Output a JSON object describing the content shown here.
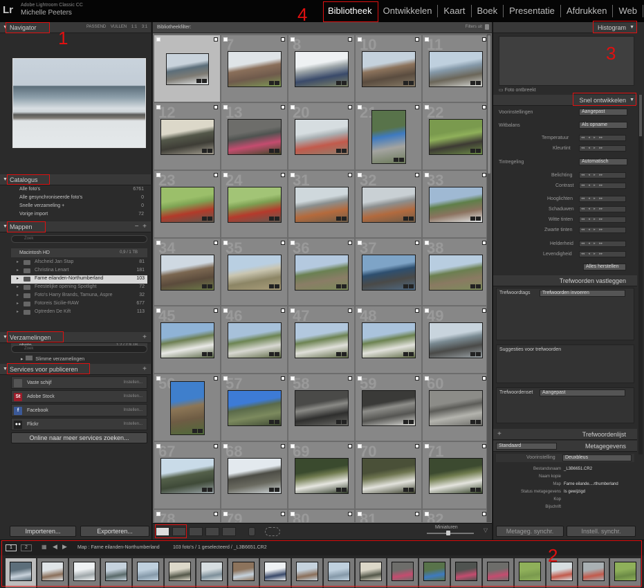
{
  "app": {
    "name": "Adobe Lightroom Classic CC",
    "user": "Michelle Peeters",
    "logo": "Lr"
  },
  "modules": [
    "Bibliotheek",
    "Ontwikkelen",
    "Kaart",
    "Boek",
    "Presentatie",
    "Afdrukken",
    "Web"
  ],
  "active_module": "Bibliotheek",
  "annotations": [
    "1",
    "2",
    "3",
    "4"
  ],
  "left": {
    "navigator": {
      "title": "Navigator",
      "options": "PASSEND  VULLEN  1:1  3:1"
    },
    "catalog": {
      "title": "Catalogus",
      "items": [
        {
          "label": "Alle foto's",
          "value": "6761"
        },
        {
          "label": "Alle gesynchroniseerde foto's",
          "value": "0"
        },
        {
          "label": "Snelle verzameling +",
          "value": "0"
        },
        {
          "label": "Vorige import",
          "value": "72"
        }
      ]
    },
    "folders": {
      "title": "Mappen",
      "filter_placeholder": "Zoek",
      "volume": {
        "name": "Macintosh HD",
        "size": "0,9 / 1 TB"
      },
      "items": [
        {
          "label": "Afscheid Jan Stap",
          "value": "81"
        },
        {
          "label": "Christina Lenart",
          "value": "181"
        },
        {
          "label": "Farne eilanden-Northumberland",
          "value": "103"
        },
        {
          "label": "Feestelijke opening Spotlight",
          "value": "72"
        },
        {
          "label": "Foto's Harry Brands, Tamuna, Aspre",
          "value": "32"
        },
        {
          "label": "Fotoreis Sicilie-RAW",
          "value": "677"
        },
        {
          "label": "Optreden De Kift",
          "value": "113"
        }
      ],
      "photo": {
        "name": "photo",
        "size": "1,2 / 2,9 TB"
      }
    },
    "collections": {
      "title": "Verzamelingen",
      "filter_placeholder": "Zoek",
      "smart": "Slimme verzamelingen"
    },
    "services": {
      "title": "Services voor publiceren",
      "items": [
        {
          "label": "Vaste schijf",
          "action": "Instellen...",
          "color": "#555555",
          "glyph": ""
        },
        {
          "label": "Adobe Stock",
          "action": "Instellen...",
          "color": "#9c1d2a",
          "glyph": "St"
        },
        {
          "label": "Facebook",
          "action": "Instellen...",
          "color": "#3b5998",
          "glyph": "f"
        },
        {
          "label": "Flickr",
          "action": "Instellen...",
          "color": "#222222",
          "glyph": "●●"
        }
      ],
      "more": "Online naar meer services zoeken..."
    },
    "import_btn": "Importeren...",
    "export_btn": "Exporteren..."
  },
  "center": {
    "filter_label": "Bibliotheekfilter:",
    "filter_right": "Filters uit",
    "mini_label": "Miniaturen",
    "cells": [
      {
        "num": "",
        "colors": [
          "#c9d3dc",
          "#5c6e7a",
          "#7e7b74",
          "#e5e9eb"
        ],
        "w": 62,
        "h": 46,
        "sel": true
      },
      {
        "num": "7",
        "colors": [
          "#dfe4e7",
          "#8a6f5a",
          "#6f5a4c",
          "#7d9a55"
        ],
        "w": 78,
        "h": 52
      },
      {
        "num": "8",
        "colors": [
          "#eef1f3",
          "#9fa7aa",
          "#3a4a6a",
          "#7f8466"
        ],
        "w": 78,
        "h": 52
      },
      {
        "num": "10",
        "colors": [
          "#c5d2dd",
          "#8c735c",
          "#5a4c3f",
          "#867a66"
        ],
        "w": 78,
        "h": 52
      },
      {
        "num": "11",
        "colors": [
          "#bfd0de",
          "#8599a9",
          "#6b6659",
          "#d4d6d3"
        ],
        "w": 78,
        "h": 52
      },
      {
        "num": "12",
        "colors": [
          "#dcd8c9",
          "#54584a",
          "#3e3d36",
          "#a39e90"
        ],
        "w": 78,
        "h": 52
      },
      {
        "num": "13",
        "colors": [
          "#6d6d6a",
          "#4f5350",
          "#c44c6f",
          "#3f4a2a"
        ],
        "w": 78,
        "h": 52
      },
      {
        "num": "20",
        "colors": [
          "#d6dde0",
          "#a9b0b3",
          "#c25a4c",
          "#8f7f6c"
        ],
        "w": 78,
        "h": 52
      },
      {
        "num": "21",
        "colors": [
          "#58734a",
          "#3e7ac0",
          "#a4a4a0",
          "#6b7a5a"
        ],
        "w": 50,
        "h": 78
      },
      {
        "num": "22",
        "colors": [
          "#7a9a4e",
          "#8fb05a",
          "#3d3a34",
          "#6b8a45"
        ],
        "w": 78,
        "h": 52
      },
      {
        "num": "23",
        "colors": [
          "#9bbf6a",
          "#7fa454",
          "#b23a2a",
          "#5c5a50"
        ],
        "w": 78,
        "h": 52
      },
      {
        "num": "24",
        "colors": [
          "#a2c476",
          "#7d9f52",
          "#b53a2c",
          "#5f5b52"
        ],
        "w": 78,
        "h": 52
      },
      {
        "num": "31",
        "colors": [
          "#cfd8dc",
          "#8a8f8f",
          "#b56a3c",
          "#6e5e4a"
        ],
        "w": 78,
        "h": 52
      },
      {
        "num": "32",
        "colors": [
          "#c9d0d4",
          "#8c8f8f",
          "#b26a3e",
          "#6d5c48"
        ],
        "w": 78,
        "h": 52
      },
      {
        "num": "33",
        "colors": [
          "#9fb9d3",
          "#5f7f49",
          "#8c7360",
          "#e3e8ea"
        ],
        "w": 78,
        "h": 52
      },
      {
        "num": "34",
        "colors": [
          "#cfd9e2",
          "#7b6751",
          "#5b4b3c",
          "#6c7a48"
        ],
        "w": 78,
        "h": 52
      },
      {
        "num": "35",
        "colors": [
          "#b9cfe2",
          "#c9c5b0",
          "#8c8565",
          "#a99d7a"
        ],
        "w": 78,
        "h": 52
      },
      {
        "num": "36",
        "colors": [
          "#b4c9df",
          "#6a8052",
          "#8a7d66",
          "#7a8a5a"
        ],
        "w": 78,
        "h": 52
      },
      {
        "num": "37",
        "colors": [
          "#7ea4c7",
          "#2e4f6f",
          "#4a4a48",
          "#4f6a84"
        ],
        "w": 78,
        "h": 52
      },
      {
        "num": "38",
        "colors": [
          "#b8cde0",
          "#6b7f50",
          "#8a7a62",
          "#7c8c5c"
        ],
        "w": 78,
        "h": 52
      },
      {
        "num": "45",
        "colors": [
          "#8fb3d6",
          "#6d7f52",
          "#e9e9e6",
          "#5c6a48"
        ],
        "w": 78,
        "h": 52
      },
      {
        "num": "46",
        "colors": [
          "#a7c1da",
          "#6c8452",
          "#d8d8d2",
          "#5e6a45"
        ],
        "w": 78,
        "h": 52
      },
      {
        "num": "47",
        "colors": [
          "#b2c8de",
          "#6d8352",
          "#e0e0da",
          "#5f6b46"
        ],
        "w": 78,
        "h": 52
      },
      {
        "num": "48",
        "colors": [
          "#aac3dc",
          "#6c8250",
          "#e2e2dc",
          "#5f6b45"
        ],
        "w": 78,
        "h": 52
      },
      {
        "num": "49",
        "colors": [
          "#c8d4dd",
          "#7a8a92",
          "#4a4a48",
          "#9aa2a6"
        ],
        "w": 78,
        "h": 52
      },
      {
        "num": "56",
        "colors": [
          "#3f7fcc",
          "#8c7656",
          "#6e5c44",
          "#4f6a3a"
        ],
        "w": 50,
        "h": 78
      },
      {
        "num": "57",
        "colors": [
          "#3d7bd6",
          "#5a6a4a",
          "#7c8a5e",
          "#3f4a34"
        ],
        "w": 78,
        "h": 52
      },
      {
        "num": "58",
        "colors": [
          "#4a4a48",
          "#8a8a86",
          "#2f2f2e",
          "#6a6a66"
        ],
        "w": 78,
        "h": 52
      },
      {
        "num": "59",
        "colors": [
          "#3a3a38",
          "#8e8e8a",
          "#555552",
          "#dcdcd8"
        ],
        "w": 78,
        "h": 52
      },
      {
        "num": "60",
        "colors": [
          "#8c8c88",
          "#5c5c58",
          "#b4b4ae",
          "#6c6c68"
        ],
        "w": 78,
        "h": 52
      },
      {
        "num": "67",
        "colors": [
          "#c9dbe8",
          "#54604a",
          "#3f4a38",
          "#9aa4a8"
        ],
        "w": 78,
        "h": 52
      },
      {
        "num": "68",
        "colors": [
          "#e3e9ee",
          "#4d4d46",
          "#6a6a60",
          "#cfd6da"
        ],
        "w": 78,
        "h": 52
      },
      {
        "num": "69",
        "colors": [
          "#3a4a2e",
          "#6f7a4e",
          "#e6e6e0",
          "#2f3a28"
        ],
        "w": 78,
        "h": 52
      },
      {
        "num": "70",
        "colors": [
          "#4a5038",
          "#6e7550",
          "#e2e2dc",
          "#3a3f2c"
        ],
        "w": 78,
        "h": 52
      },
      {
        "num": "71",
        "colors": [
          "#3c4a30",
          "#707c4e",
          "#e4e4de",
          "#324026"
        ],
        "w": 78,
        "h": 52
      },
      {
        "num": "78",
        "colors": [
          "#878787",
          "#878787",
          "#878787",
          "#878787"
        ],
        "w": 0,
        "h": 0
      },
      {
        "num": "79",
        "colors": [
          "#878787",
          "#878787",
          "#878787",
          "#878787"
        ],
        "w": 0,
        "h": 0
      },
      {
        "num": "80",
        "colors": [
          "#878787",
          "#878787",
          "#878787",
          "#878787"
        ],
        "w": 0,
        "h": 0
      },
      {
        "num": "81",
        "colors": [
          "#878787",
          "#878787",
          "#878787",
          "#878787"
        ],
        "w": 0,
        "h": 0
      },
      {
        "num": "82",
        "colors": [
          "#878787",
          "#878787",
          "#878787",
          "#878787"
        ],
        "w": 0,
        "h": 0
      }
    ]
  },
  "right": {
    "histogram": {
      "title": "Histogram",
      "caption": "Foto ontbreekt"
    },
    "quick_develop": {
      "title": "Snel ontwikkelen",
      "preset_label": "Voorinstellingen",
      "preset_value": "Aangepast",
      "wb_label": "Witbalans",
      "wb_value": "Als opname",
      "temp": "Temperatuur",
      "tint": "Kleurtint",
      "tone_label": "Tintregeling",
      "tone_value": "Automatisch",
      "exposure": "Belichting",
      "contrast": "Contrast",
      "highlights": "Hooglichten",
      "shadows": "Schaduwen",
      "whites": "Witte tinten",
      "blacks": "Zwarte tinten",
      "clarity": "Helderheid",
      "vibrance": "Levendigheid",
      "reset": "Alles herstellen"
    },
    "keywording": {
      "title": "Trefwoorden vastleggen",
      "tags_label": "Trefwoordtags",
      "tags_value": "Trefwoorden invoeren",
      "suggestions": "Suggesties voor trefwoorden",
      "set_label": "Trefwoordenset",
      "set_value": "Aangepast"
    },
    "keyword_list": {
      "title": "Trefwoordenlijst"
    },
    "metadata": {
      "title": "Metagegevens",
      "preset_label": "Standaard",
      "voorinstelling_label": "Voorinstelling",
      "voorinstelling_value": "Deuxbleus",
      "rows": [
        {
          "k": "Bestandsnaam",
          "v": "_L3B6651.CR2"
        },
        {
          "k": "Naam kopie",
          "v": ""
        },
        {
          "k": "Map",
          "v": "Farne eilande....rthumberland"
        },
        {
          "k": "Status metagegevens",
          "v": "Is gewijzigd"
        },
        {
          "k": "Kop",
          "v": ""
        },
        {
          "k": "Bijschrift",
          "v": ""
        }
      ]
    },
    "sync_meta": "Metageg. synchr.",
    "sync_settings": "Instell. synchr."
  },
  "filmstrip": {
    "page1": "1",
    "page2": "2",
    "path": "Map : Farne eilanden-Northumberland",
    "count": "103 foto's / 1 geselecteerd / _L3B6651.CR2",
    "thumbs": [
      [
        "#c9d3dc",
        "#5c6e7a"
      ],
      [
        "#8a6f5a",
        "#dfe4e7"
      ],
      [
        "#9fa7aa",
        "#eef1f3"
      ],
      [
        "#5a6a6a",
        "#c5d2dd"
      ],
      [
        "#8599a9",
        "#bfd0de"
      ],
      [
        "#54584a",
        "#dcd8c9"
      ],
      [
        "#7d8f9a",
        "#d6dde0"
      ],
      [
        "#c5d2dd",
        "#8c735c"
      ],
      [
        "#3a4a6a",
        "#eef1f3"
      ],
      [
        "#8a6f5a",
        "#c5d2dd"
      ],
      [
        "#8599a9",
        "#bfd0de"
      ],
      [
        "#54584a",
        "#dcd8c9"
      ],
      [
        "#c44c6f",
        "#6d6d6a"
      ],
      [
        "#3e7ac0",
        "#58734a"
      ],
      [
        "#c44c6f",
        "#4f5350"
      ],
      [
        "#c44c6f",
        "#6d6d6a"
      ],
      [
        "#7a9a4e",
        "#8fb05a"
      ],
      [
        "#c25a4c",
        "#d6dde0"
      ],
      [
        "#c25a4c",
        "#a9b0b3"
      ],
      [
        "#6b8a45",
        "#8fb05a"
      ]
    ]
  }
}
